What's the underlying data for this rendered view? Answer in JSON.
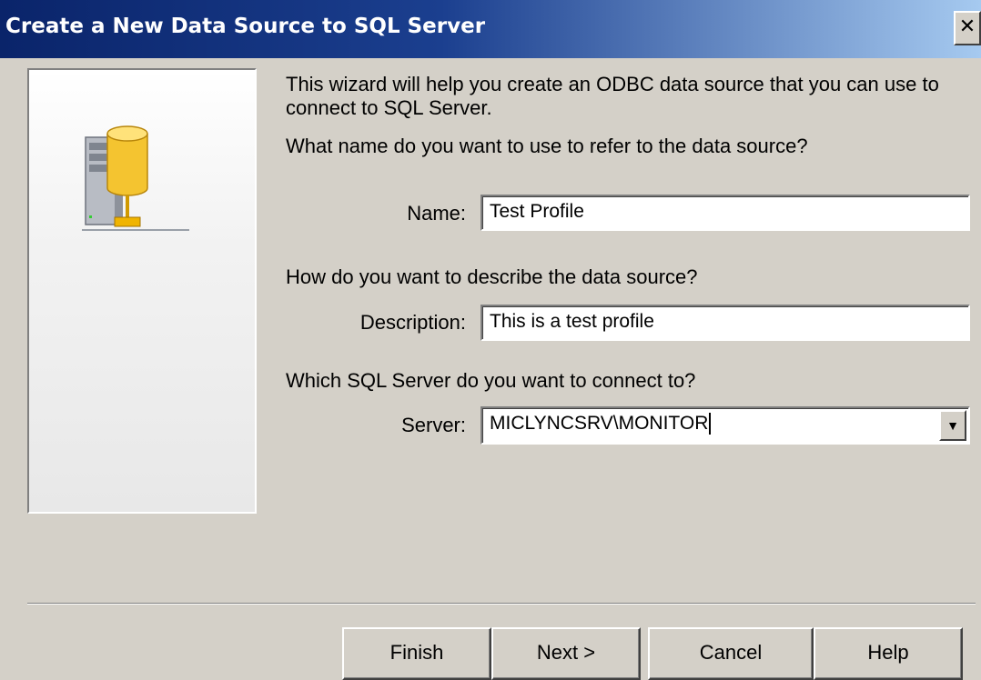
{
  "window": {
    "title": "Create a New Data Source to SQL Server",
    "close_glyph": "✕"
  },
  "wizard": {
    "intro_line1": "This wizard will help you create an ODBC data source that you can use to",
    "intro_line2": "connect to SQL Server.",
    "name_question": "What name do you want to use to refer to the data source?",
    "name_label": "Name:",
    "name_value": "Test Profile",
    "description_question": "How do you want to describe the data source?",
    "description_label": "Description:",
    "description_value": "This is a test profile",
    "server_question": "Which SQL Server do you want to connect to?",
    "server_label": "Server:",
    "server_value": "MICLYNCSRV\\MONITOR"
  },
  "buttons": {
    "finish": "Finish",
    "next": "Next >",
    "cancel": "Cancel",
    "help": "Help"
  },
  "icons": {
    "graphic": "database-server-icon",
    "dropdown": "chevron-down-icon"
  }
}
